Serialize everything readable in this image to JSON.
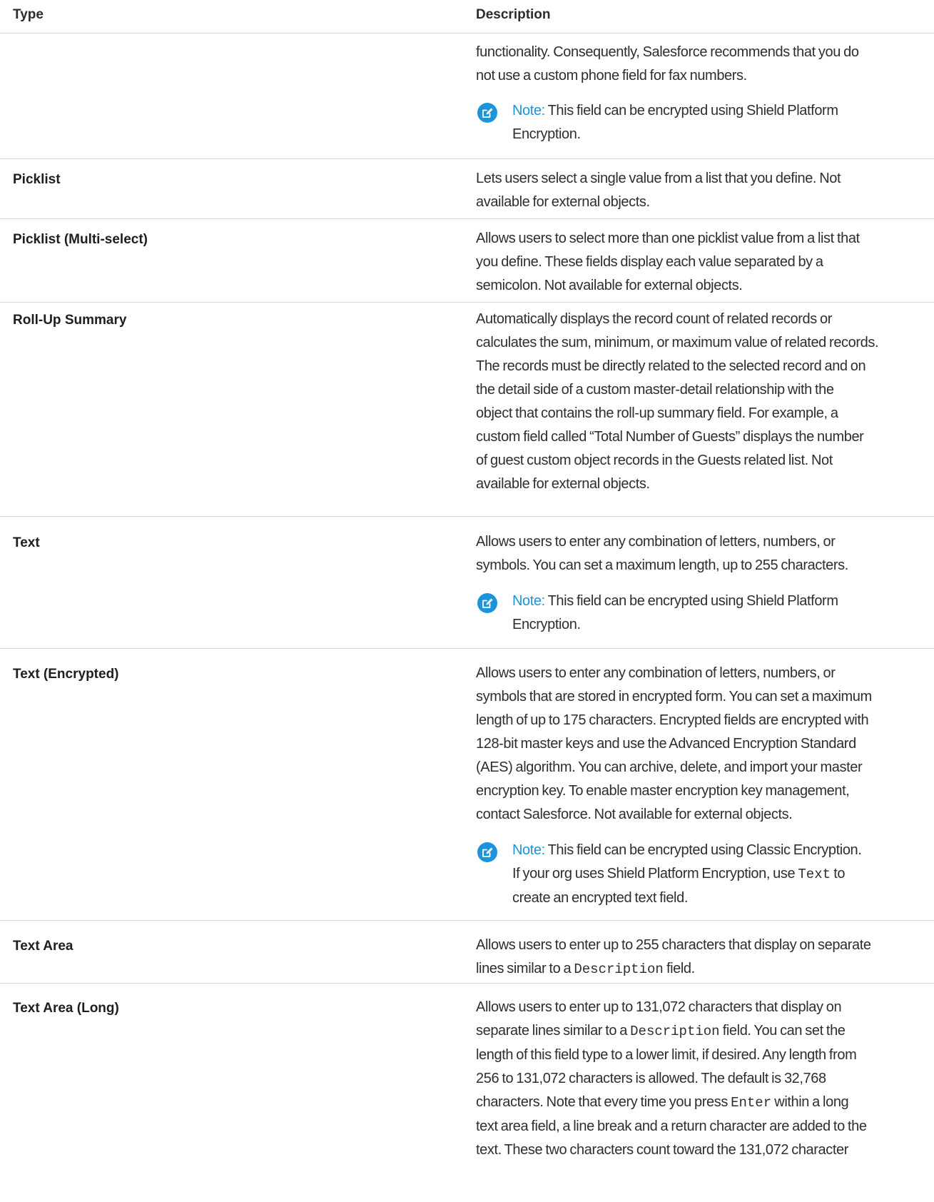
{
  "header": {
    "type_label": "Type",
    "description_label": "Description"
  },
  "rows": [
    {
      "type": "",
      "description_lines": [
        "functionality. Consequently, Salesforce recommends that you do",
        "not use a custom phone field for fax numbers."
      ],
      "note": {
        "label": "Note:",
        "lines": [
          "This field can be encrypted using Shield Platform",
          "Encryption."
        ]
      }
    },
    {
      "type": "Picklist",
      "description_lines": [
        "Lets users select a single value from a list that you define. Not",
        "available for external objects."
      ]
    },
    {
      "type": "Picklist (Multi-select)",
      "description_lines": [
        "Allows users to select more than one picklist value from a list that",
        "you define. These fields display each value separated by a",
        "semicolon. Not available for external objects."
      ]
    },
    {
      "type": "Roll-Up Summary",
      "description_lines": [
        "Automatically displays the record count of related records or",
        "calculates the sum, minimum, or maximum value of related records.",
        "The records must be directly related to the selected record and on",
        "the detail side of a custom master-detail relationship with the",
        "object that contains the roll-up summary field. For example, a",
        "custom field called “Total Number of Guests” displays the number",
        "of guest custom object records in the Guests related list. Not",
        "available for external objects."
      ]
    },
    {
      "type": "Text",
      "description_lines": [
        "Allows users to enter any combination of letters, numbers, or",
        "symbols. You can set a maximum length, up to 255 characters."
      ],
      "note": {
        "label": "Note:",
        "lines": [
          "This field can be encrypted using Shield Platform",
          "Encryption."
        ]
      }
    },
    {
      "type": "Text (Encrypted)",
      "description_lines": [
        "Allows users to enter any combination of letters, numbers, or",
        "symbols that are stored in encrypted form. You can set a maximum",
        "length of up to 175 characters. Encrypted fields are encrypted with",
        "128-bit master keys and use the Advanced Encryption Standard",
        "(AES) algorithm. You can archive, delete, and import your master",
        "encryption key. To enable master encryption key management,",
        "contact Salesforce. Not available for external objects."
      ],
      "note": {
        "label": "Note:",
        "line1": "This field can be encrypted using Classic Encryption.",
        "line2_before": "If your org uses Shield Platform Encryption, use",
        "line2_code": "Text",
        "line2_after": "to",
        "line3": "create an encrypted text field."
      }
    },
    {
      "type": "Text Area",
      "line1": "Allows users to enter up to 255 characters that display on separate",
      "line2_before": "lines similar to a",
      "line2_code": "Description",
      "line2_after": "field."
    },
    {
      "type": "Text Area (Long)",
      "line1": "Allows users to enter up to 131,072 characters that display on",
      "line2_before": "separate lines similar to a",
      "line2_code": "Description",
      "line2_after": "field. You can set the",
      "line3": "length of this field type to a lower limit, if desired. Any length from",
      "line4": "256 to 131,072 characters is allowed. The default is 32,768",
      "line5_before": "characters. Note that every time you press",
      "line5_code": "Enter",
      "line5_after": "within a long",
      "line6": "text area field, a line break and a return character are added to the",
      "line7": "text. These two characters count toward the 131,072 character"
    }
  ]
}
